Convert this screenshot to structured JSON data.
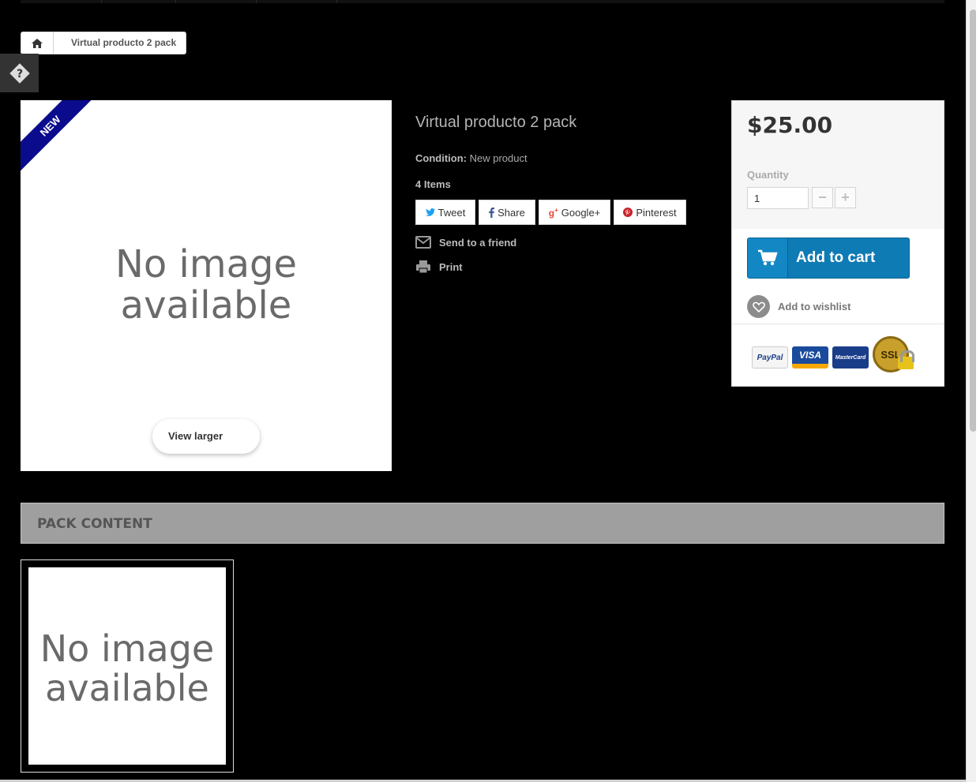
{
  "breadcrumb": {
    "current": "Virtual producto 2 pack"
  },
  "product": {
    "badge": "NEW",
    "image_placeholder": [
      "No image",
      "available"
    ],
    "view_larger_label": "View larger",
    "title": "Virtual producto 2 pack",
    "condition_label": "Condition:",
    "condition_value": "New product",
    "pack_count": "4 Items"
  },
  "social": {
    "tweet": "Tweet",
    "share": "Share",
    "google": "Google+",
    "pinterest": "Pinterest"
  },
  "actions": {
    "send_to_friend": "Send to a friend",
    "print": "Print"
  },
  "buybox": {
    "price": "$25.00",
    "quantity_label": "Quantity",
    "quantity_value": "1",
    "add_to_cart": "Add to cart",
    "add_to_wishlist": "Add to wishlist",
    "payment_logos": [
      "PayPal",
      "VISA",
      "MasterCard",
      "SSL"
    ]
  },
  "pack": {
    "title": "PACK CONTENT",
    "item_placeholder": [
      "No image",
      "available"
    ]
  },
  "colors": {
    "cart_button": "#0f7bb5",
    "ribbon": "#0b0b8e",
    "pack_header": "#9f9f9f"
  }
}
